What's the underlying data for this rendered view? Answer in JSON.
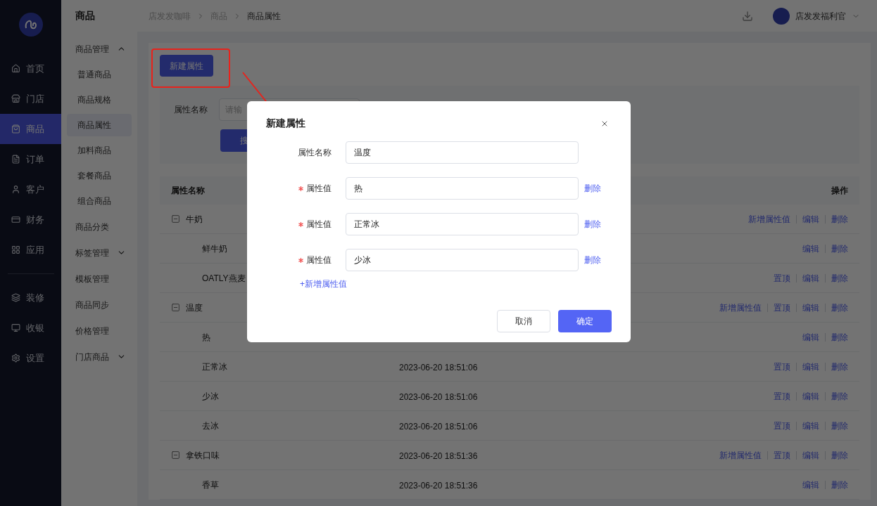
{
  "nav_main": [
    {
      "label": "首页",
      "selected": false
    },
    {
      "label": "门店",
      "selected": false
    },
    {
      "label": "商品",
      "selected": true
    },
    {
      "label": "订单",
      "selected": false
    },
    {
      "label": "客户",
      "selected": false
    },
    {
      "label": "财务",
      "selected": false
    },
    {
      "label": "应用",
      "selected": false
    }
  ],
  "nav_tools": [
    {
      "label": "装修",
      "selected": false
    },
    {
      "label": "收银",
      "selected": false
    },
    {
      "label": "设置",
      "selected": false
    }
  ],
  "subnav": {
    "title": "商品",
    "items": [
      {
        "label": "商品管理",
        "kind": "group",
        "expanded": true,
        "children": [
          {
            "label": "普通商品",
            "selected": false
          },
          {
            "label": "商品规格",
            "selected": false
          },
          {
            "label": "商品属性",
            "selected": true
          },
          {
            "label": "加料商品",
            "selected": false
          },
          {
            "label": "套餐商品",
            "selected": false
          },
          {
            "label": "组合商品",
            "selected": false
          }
        ]
      },
      {
        "label": "商品分类",
        "kind": "link"
      },
      {
        "label": "标签管理",
        "kind": "group",
        "expanded": false
      },
      {
        "label": "模板管理",
        "kind": "link"
      },
      {
        "label": "商品同步",
        "kind": "link"
      },
      {
        "label": "价格管理",
        "kind": "link"
      },
      {
        "label": "门店商品",
        "kind": "group",
        "expanded": false
      }
    ]
  },
  "breadcrumb": [
    "店发发咖啡",
    "商品",
    "商品属性"
  ],
  "header": {
    "user": "店发发福利官"
  },
  "new_button": "新建属性",
  "search": {
    "label": "属性名称",
    "placeholder": "请输",
    "button": "搜"
  },
  "table": {
    "columns": [
      "属性名称",
      "操作"
    ],
    "rows": [
      {
        "name": "牛奶",
        "expanded": true,
        "actions": [
          "新增属性值",
          "编辑",
          "删除"
        ],
        "children": [
          {
            "name": "鲜牛奶",
            "actions": [
              "编辑",
              "删除"
            ]
          },
          {
            "name": "OATLY燕麦",
            "actions": [
              "置顶",
              "编辑",
              "删除"
            ]
          }
        ]
      },
      {
        "name": "温度",
        "expanded": true,
        "actions": [
          "新增属性值",
          "置顶",
          "编辑",
          "删除"
        ],
        "children": [
          {
            "name": "热",
            "actions": [
              "编辑",
              "删除"
            ]
          },
          {
            "name": "正常冰",
            "time": "2023-06-20 18:51:06",
            "actions": [
              "置顶",
              "编辑",
              "删除"
            ]
          },
          {
            "name": "少冰",
            "time": "2023-06-20 18:51:06",
            "actions": [
              "置顶",
              "编辑",
              "删除"
            ]
          },
          {
            "name": "去冰",
            "time": "2023-06-20 18:51:06",
            "actions": [
              "置顶",
              "编辑",
              "删除"
            ]
          }
        ]
      },
      {
        "name": "拿铁口味",
        "time": "2023-06-20 18:51:36",
        "expanded": true,
        "actions": [
          "新增属性值",
          "置顶",
          "编辑",
          "删除"
        ],
        "children": [
          {
            "name": "香草",
            "time": "2023-06-20 18:51:36",
            "actions": [
              "编辑",
              "删除"
            ]
          }
        ]
      }
    ]
  },
  "dialog": {
    "title": "新建属性",
    "fields": [
      {
        "label": "属性名称",
        "required": false,
        "value": "温度"
      },
      {
        "label": "属性值",
        "required": true,
        "value": "热",
        "delete": "删除"
      },
      {
        "label": "属性值",
        "required": true,
        "value": "正常冰",
        "delete": "删除"
      },
      {
        "label": "属性值",
        "required": true,
        "value": "少冰",
        "delete": "删除"
      }
    ],
    "add_link": "+新增属性值",
    "buttons": [
      {
        "label": "取消",
        "kind": "secondary"
      },
      {
        "label": "确定",
        "kind": "primary"
      }
    ]
  }
}
